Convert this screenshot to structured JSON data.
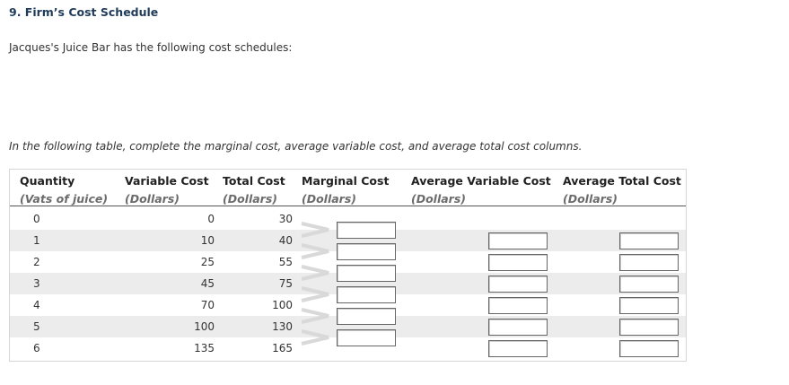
{
  "question": {
    "title": "9. Firm’s Cost Schedule",
    "intro": "Jacques's Juice Bar has the following cost schedules:",
    "instruction": "In the following table, complete the marginal cost, average variable cost, and average total cost columns."
  },
  "table": {
    "headers": [
      {
        "line1": "Quantity",
        "line2": "(Vats of juice)"
      },
      {
        "line1": "Variable Cost",
        "line2": "(Dollars)"
      },
      {
        "line1": "Total Cost",
        "line2": "(Dollars)"
      },
      {
        "line1": "Marginal Cost",
        "line2": "(Dollars)"
      },
      {
        "line1": "Average Variable Cost",
        "line2": "(Dollars)"
      },
      {
        "line1": "Average Total Cost",
        "line2": "(Dollars)"
      }
    ],
    "rows": [
      {
        "quantity": "0",
        "variable_cost": "0",
        "total_cost": "30"
      },
      {
        "quantity": "1",
        "variable_cost": "10",
        "total_cost": "40"
      },
      {
        "quantity": "2",
        "variable_cost": "25",
        "total_cost": "55"
      },
      {
        "quantity": "3",
        "variable_cost": "45",
        "total_cost": "75"
      },
      {
        "quantity": "4",
        "variable_cost": "70",
        "total_cost": "100"
      },
      {
        "quantity": "5",
        "variable_cost": "100",
        "total_cost": "130"
      },
      {
        "quantity": "6",
        "variable_cost": "135",
        "total_cost": "165"
      }
    ],
    "marginal_cost_inputs": [
      "",
      "",
      "",
      "",
      "",
      ""
    ],
    "avc_inputs": [
      "",
      "",
      "",
      "",
      "",
      ""
    ],
    "atc_inputs": [
      "",
      "",
      "",
      "",
      "",
      ""
    ]
  },
  "colors": {
    "title": "#1f3b5a",
    "row_shade": "#ececec",
    "arrow": "#d9d9d9"
  }
}
